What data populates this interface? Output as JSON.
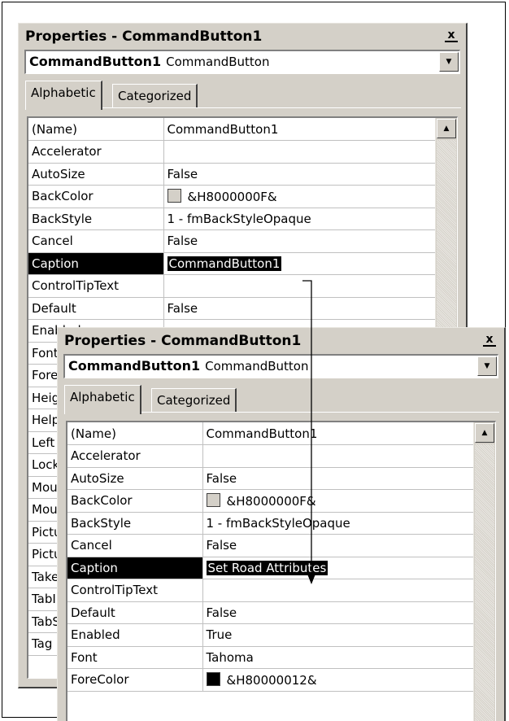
{
  "back_window": {
    "title": "Properties - CommandButton1",
    "close_glyph": "x",
    "combo": {
      "name": "CommandButton1",
      "type": "CommandButton"
    },
    "tabs": [
      "Alphabetic",
      "Categorized"
    ],
    "rows": [
      {
        "name": "(Name)",
        "value": "CommandButton1"
      },
      {
        "name": "Accelerator",
        "value": ""
      },
      {
        "name": "AutoSize",
        "value": "False"
      },
      {
        "name": "BackColor",
        "value": "&H8000000F&",
        "swatch": "#d4d0c8"
      },
      {
        "name": "BackStyle",
        "value": "1 - fmBackStyleOpaque"
      },
      {
        "name": "Cancel",
        "value": "False"
      },
      {
        "name": "Caption",
        "value": "CommandButton1",
        "selected": true
      },
      {
        "name": "ControlTipText",
        "value": ""
      },
      {
        "name": "Default",
        "value": "False"
      },
      {
        "name": "Enabled",
        "value": ""
      },
      {
        "name": "Font",
        "value": ""
      },
      {
        "name": "ForeColor",
        "value": ""
      },
      {
        "name": "Height",
        "value": ""
      },
      {
        "name": "HelpContextID",
        "value": ""
      },
      {
        "name": "Left",
        "value": ""
      },
      {
        "name": "Locked",
        "value": ""
      },
      {
        "name": "MouseIcon",
        "value": ""
      },
      {
        "name": "MousePointer",
        "value": ""
      },
      {
        "name": "Picture",
        "value": ""
      },
      {
        "name": "PicturePosition",
        "value": ""
      },
      {
        "name": "TakeFocusOnClick",
        "value": ""
      },
      {
        "name": "TabIndex",
        "value": ""
      },
      {
        "name": "TabStop",
        "value": ""
      },
      {
        "name": "Tag",
        "value": ""
      }
    ]
  },
  "front_window": {
    "title": "Properties - CommandButton1",
    "close_glyph": "x",
    "combo": {
      "name": "CommandButton1",
      "type": "CommandButton"
    },
    "tabs": [
      "Alphabetic",
      "Categorized"
    ],
    "rows": [
      {
        "name": "(Name)",
        "value": "CommandButton1"
      },
      {
        "name": "Accelerator",
        "value": ""
      },
      {
        "name": "AutoSize",
        "value": "False"
      },
      {
        "name": "BackColor",
        "value": "&H8000000F&",
        "swatch": "#d4d0c8"
      },
      {
        "name": "BackStyle",
        "value": "1 - fmBackStyleOpaque"
      },
      {
        "name": "Cancel",
        "value": "False"
      },
      {
        "name": "Caption",
        "value": "Set Road Attributes",
        "selected": true
      },
      {
        "name": "ControlTipText",
        "value": ""
      },
      {
        "name": "Default",
        "value": "False"
      },
      {
        "name": "Enabled",
        "value": "True"
      },
      {
        "name": "Font",
        "value": "Tahoma"
      },
      {
        "name": "ForeColor",
        "value": "&H80000012&",
        "swatch": "#000000"
      }
    ]
  }
}
